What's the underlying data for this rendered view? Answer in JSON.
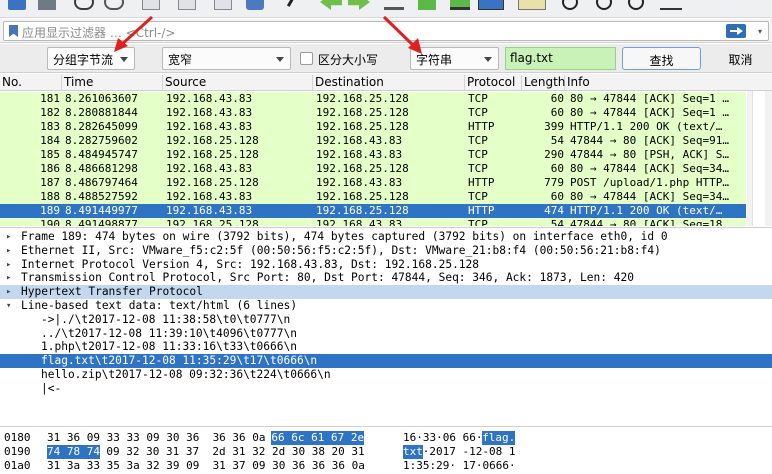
{
  "filter": {
    "placeholder": "应用显示过滤器 … <Ctrl-/>"
  },
  "find_bar": {
    "search_in": "分组字节流",
    "char_width": "宽窄",
    "case_sensitive_label": "区分大小写",
    "search_type": "字符串",
    "search_value": "flag.txt",
    "find_button": "查找",
    "cancel_button": "取消"
  },
  "packet_list": {
    "columns": [
      "No.",
      "Time",
      "Source",
      "Destination",
      "Protocol",
      "Length",
      "Info"
    ],
    "rows": [
      {
        "no": "181",
        "time": "8.261063607",
        "src": "192.168.43.83",
        "dst": "192.168.25.128",
        "proto": "TCP",
        "len": "60",
        "info": "80 → 47844 [ACK] Seq=1 …"
      },
      {
        "no": "182",
        "time": "8.280881844",
        "src": "192.168.43.83",
        "dst": "192.168.25.128",
        "proto": "TCP",
        "len": "60",
        "info": "80 → 47844 [ACK] Seq=1 …"
      },
      {
        "no": "183",
        "time": "8.282645099",
        "src": "192.168.43.83",
        "dst": "192.168.25.128",
        "proto": "HTTP",
        "len": "399",
        "info": "HTTP/1.1 200 OK  (text/…"
      },
      {
        "no": "184",
        "time": "8.282759602",
        "src": "192.168.25.128",
        "dst": "192.168.43.83",
        "proto": "TCP",
        "len": "54",
        "info": "47844 → 80 [ACK] Seq=91…"
      },
      {
        "no": "185",
        "time": "8.484945747",
        "src": "192.168.25.128",
        "dst": "192.168.43.83",
        "proto": "TCP",
        "len": "290",
        "info": "47844 → 80 [PSH, ACK] S…"
      },
      {
        "no": "186",
        "time": "8.486681298",
        "src": "192.168.43.83",
        "dst": "192.168.25.128",
        "proto": "TCP",
        "len": "60",
        "info": "80 → 47844 [ACK] Seq=34…"
      },
      {
        "no": "187",
        "time": "8.486797464",
        "src": "192.168.25.128",
        "dst": "192.168.43.83",
        "proto": "HTTP",
        "len": "779",
        "info": "POST /upload/1.php HTTP…"
      },
      {
        "no": "188",
        "time": "8.488527592",
        "src": "192.168.43.83",
        "dst": "192.168.25.128",
        "proto": "TCP",
        "len": "60",
        "info": "80 → 47844 [ACK] Seq=34…"
      },
      {
        "no": "189",
        "time": "8.491449977",
        "src": "192.168.43.83",
        "dst": "192.168.25.128",
        "proto": "HTTP",
        "len": "474",
        "info": "HTTP/1.1 200 OK  (text/…"
      },
      {
        "no": "190",
        "time": "8.491498877",
        "src": "192.168.25.128",
        "dst": "192.168.43.83",
        "proto": "TCP",
        "len": "54",
        "info": "47844 → 80 [ACK] Seq=18…"
      }
    ],
    "selected_row": "189"
  },
  "details": [
    {
      "indent": 0,
      "arrow": "▸",
      "text": "Frame 189: 474 bytes on wire (3792 bits), 474 bytes captured (3792 bits) on interface eth0, id 0"
    },
    {
      "indent": 0,
      "arrow": "▸",
      "text": "Ethernet II, Src: VMware_f5:c2:5f (00:50:56:f5:c2:5f), Dst: VMware_21:b8:f4 (00:50:56:21:b8:f4)"
    },
    {
      "indent": 0,
      "arrow": "▸",
      "text": "Internet Protocol Version 4, Src: 192.168.43.83, Dst: 192.168.25.128"
    },
    {
      "indent": 0,
      "arrow": "▸",
      "text": "Transmission Control Protocol, Src Port: 80, Dst Port: 47844, Seq: 346, Ack: 1873, Len: 420"
    },
    {
      "indent": 0,
      "arrow": "▸",
      "text": "Hypertext Transfer Protocol"
    },
    {
      "indent": 0,
      "arrow": "▾",
      "text": "Line-based text data: text/html (6 lines)"
    },
    {
      "indent": 1,
      "arrow": "",
      "text": "->|./\\t2017-12-08 11:38:58\\t0\\t0777\\n"
    },
    {
      "indent": 1,
      "arrow": "",
      "text": "../\\t2017-12-08 11:39:10\\t4096\\t0777\\n"
    },
    {
      "indent": 1,
      "arrow": "",
      "text": "1.php\\t2017-12-08 11:33:16\\t33\\t0666\\n"
    },
    {
      "indent": 1,
      "arrow": "",
      "text": "flag.txt\\t2017-12-08 11:35:29\\t17\\t0666\\n"
    },
    {
      "indent": 1,
      "arrow": "",
      "text": "hello.zip\\t2017-12-08 09:32:36\\t224\\t0666\\n"
    },
    {
      "indent": 1,
      "arrow": "",
      "text": "|<-"
    }
  ],
  "bytes": [
    {
      "offset": "0180",
      "hex_a": "31 36 09 33 33 09 30 36  36 36 0a",
      "hex_sel": "66 6c 61 67 2e",
      "hex_b": "",
      "ascii_a": "16·33·06 66·",
      "ascii_sel": "flag.",
      "ascii_b": ""
    },
    {
      "offset": "0190",
      "hex_a": "",
      "hex_sel": "74 78 74",
      "hex_b": "09 32 30 31 37  2d 31 32 2d 30 38 20 31",
      "ascii_a": "",
      "ascii_sel": "txt",
      "ascii_b": "·2017 -12-08 1"
    },
    {
      "offset": "01a0",
      "hex_a": "31 3a 33 35 3a 32 39 09  31 37 09 30 36 36 36 0a",
      "hex_sel": "",
      "hex_b": "",
      "ascii_a": "1:35:29· 17·0666·",
      "ascii_sel": "",
      "ascii_b": ""
    }
  ],
  "colors": {
    "row_bg": "#e4ffc7",
    "selection": "#2f74c4",
    "find_text_bg": "#c9f2b8",
    "arrow": "#e02020"
  }
}
